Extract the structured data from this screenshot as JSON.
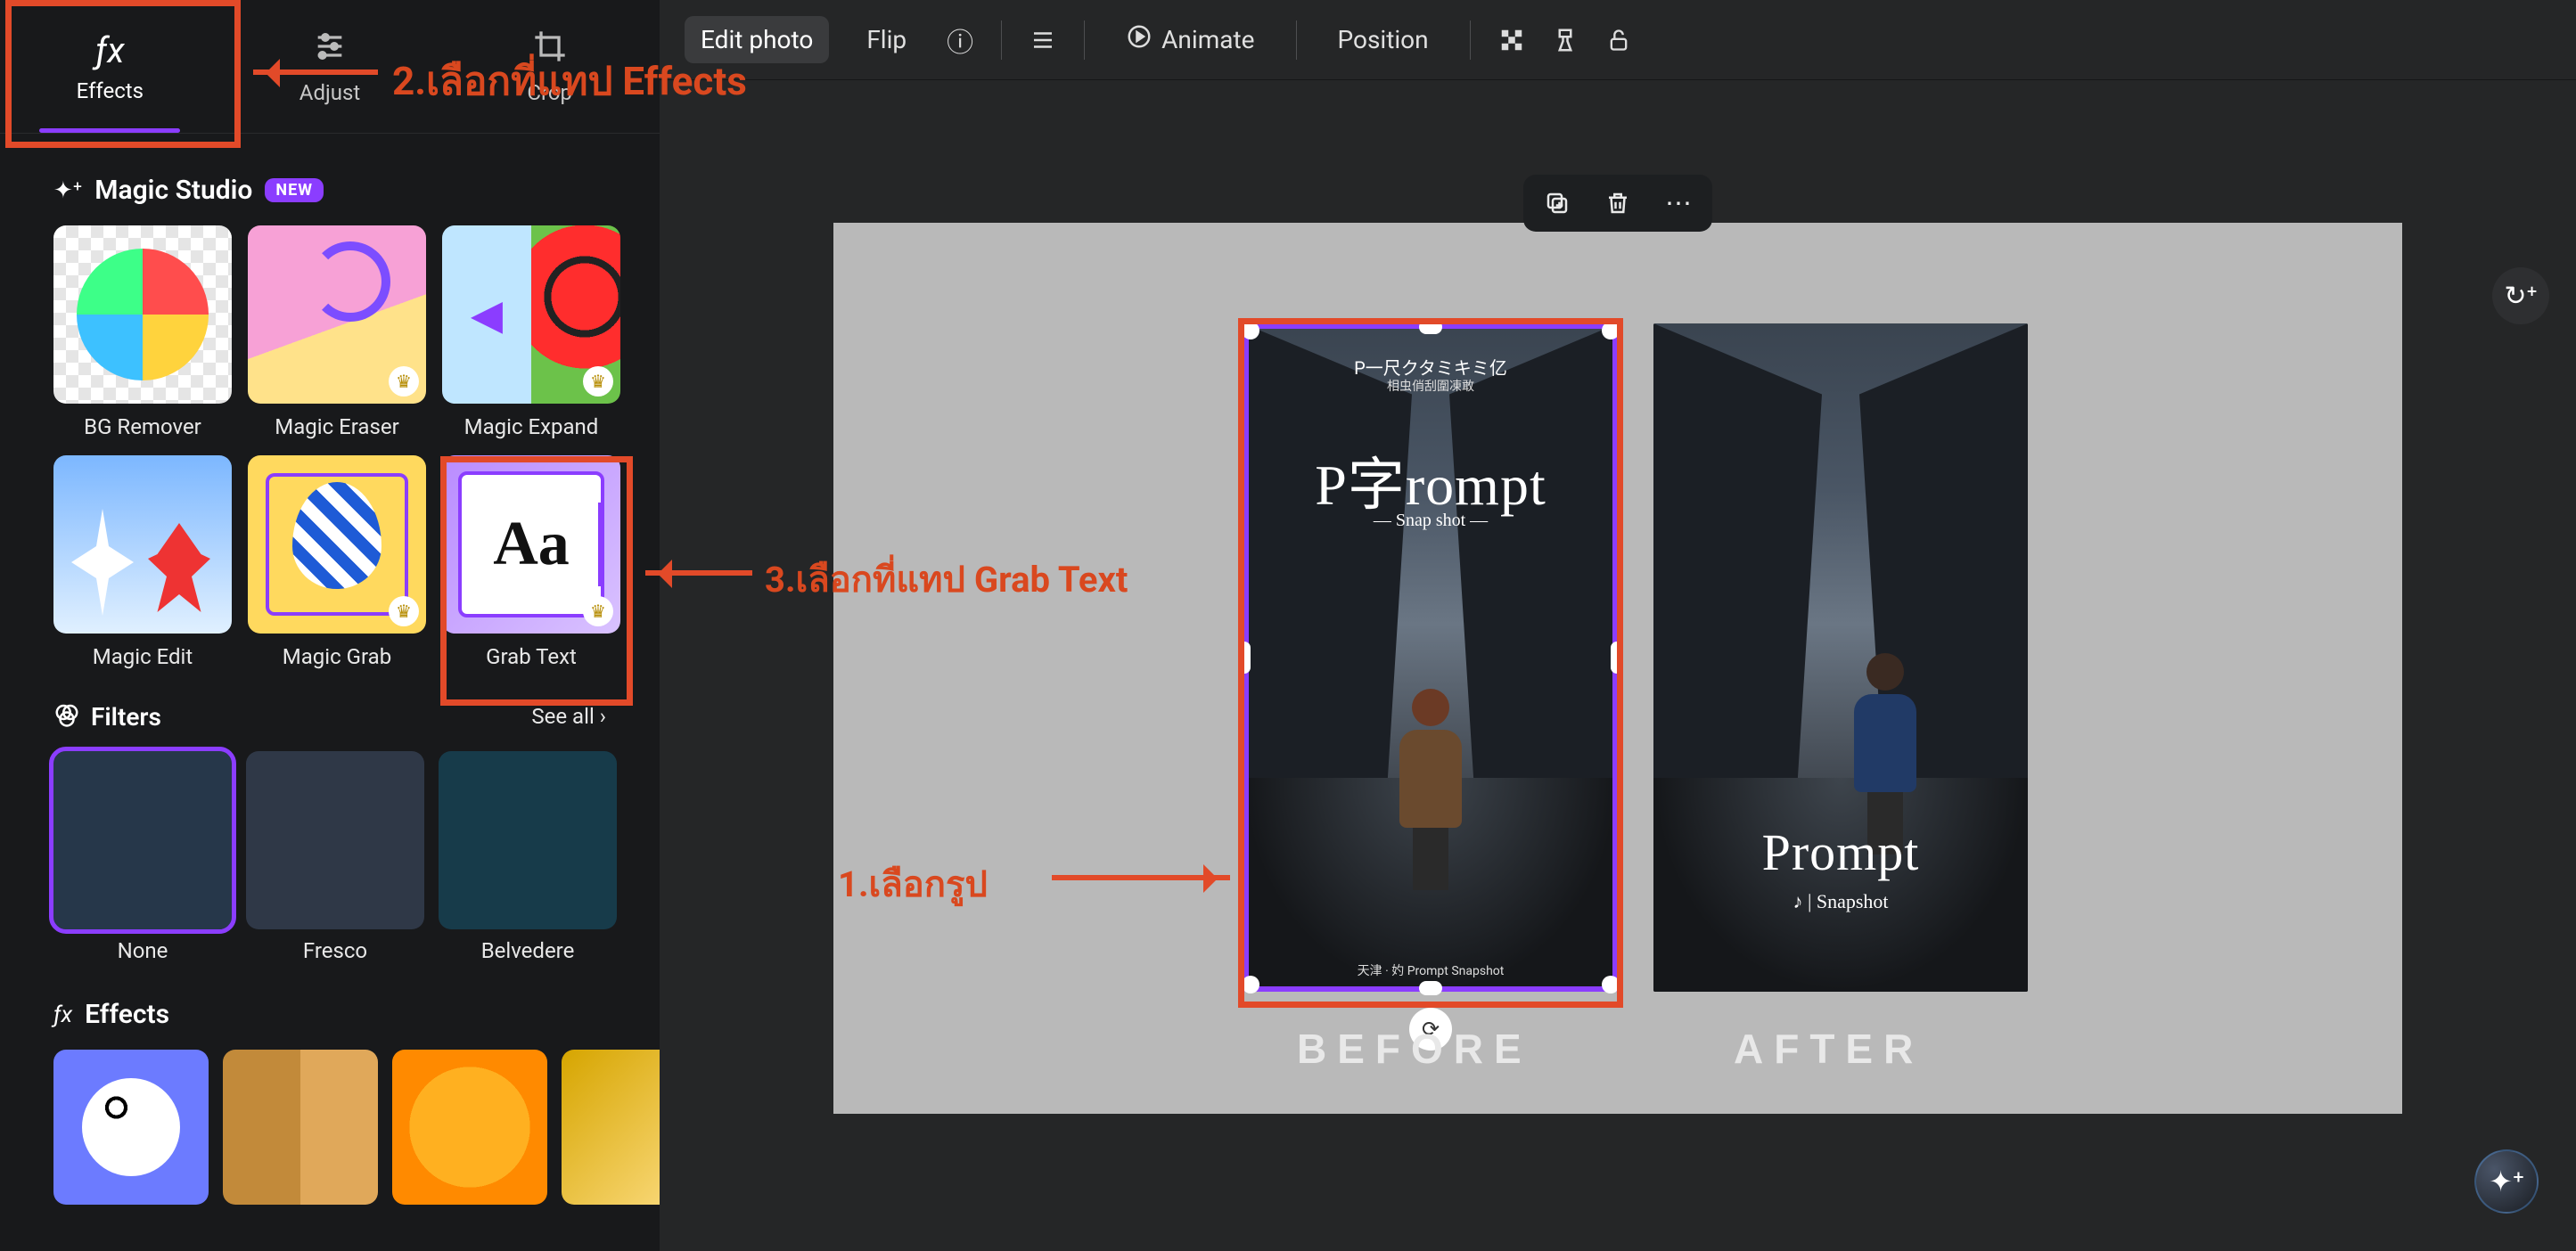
{
  "sidebar_tabs": {
    "effects": "Effects",
    "adjust": "Adjust",
    "crop": "Crop"
  },
  "magic_studio": {
    "title": "Magic Studio",
    "badge": "NEW",
    "tiles": {
      "bg_remover": "BG Remover",
      "magic_eraser": "Magic Eraser",
      "magic_expand": "Magic Expand",
      "magic_edit": "Magic Edit",
      "magic_grab": "Magic Grab",
      "grab_text": "Grab Text",
      "grab_text_glyph": "Aa"
    }
  },
  "filters": {
    "title": "Filters",
    "see_all": "See all",
    "items": {
      "none": "None",
      "fresco": "Fresco",
      "belvedere": "Belvedere"
    }
  },
  "effects": {
    "title": "Effects"
  },
  "toolbar": {
    "edit_photo": "Edit photo",
    "flip": "Flip",
    "animate": "Animate",
    "position": "Position"
  },
  "canvas": {
    "before_label": "BEFORE",
    "after_label": "AFTER",
    "poster_before": {
      "jp1": "P一尺クタミキミ亿",
      "jp2": "相虫俏刮圍凍敢",
      "title": "P字rompt",
      "subtitle": "— Snap shot —",
      "credits": "天津 · 妁    Prompt Snapshot"
    },
    "poster_after": {
      "title": "Prompt",
      "subtitle": "♪ | Snapshot"
    }
  },
  "annotations": {
    "step1": "1.เลือกรูป",
    "step2": "2.เลือกที่แทป Effects",
    "step3": "3.เลือกที่แทป Grab Text"
  }
}
